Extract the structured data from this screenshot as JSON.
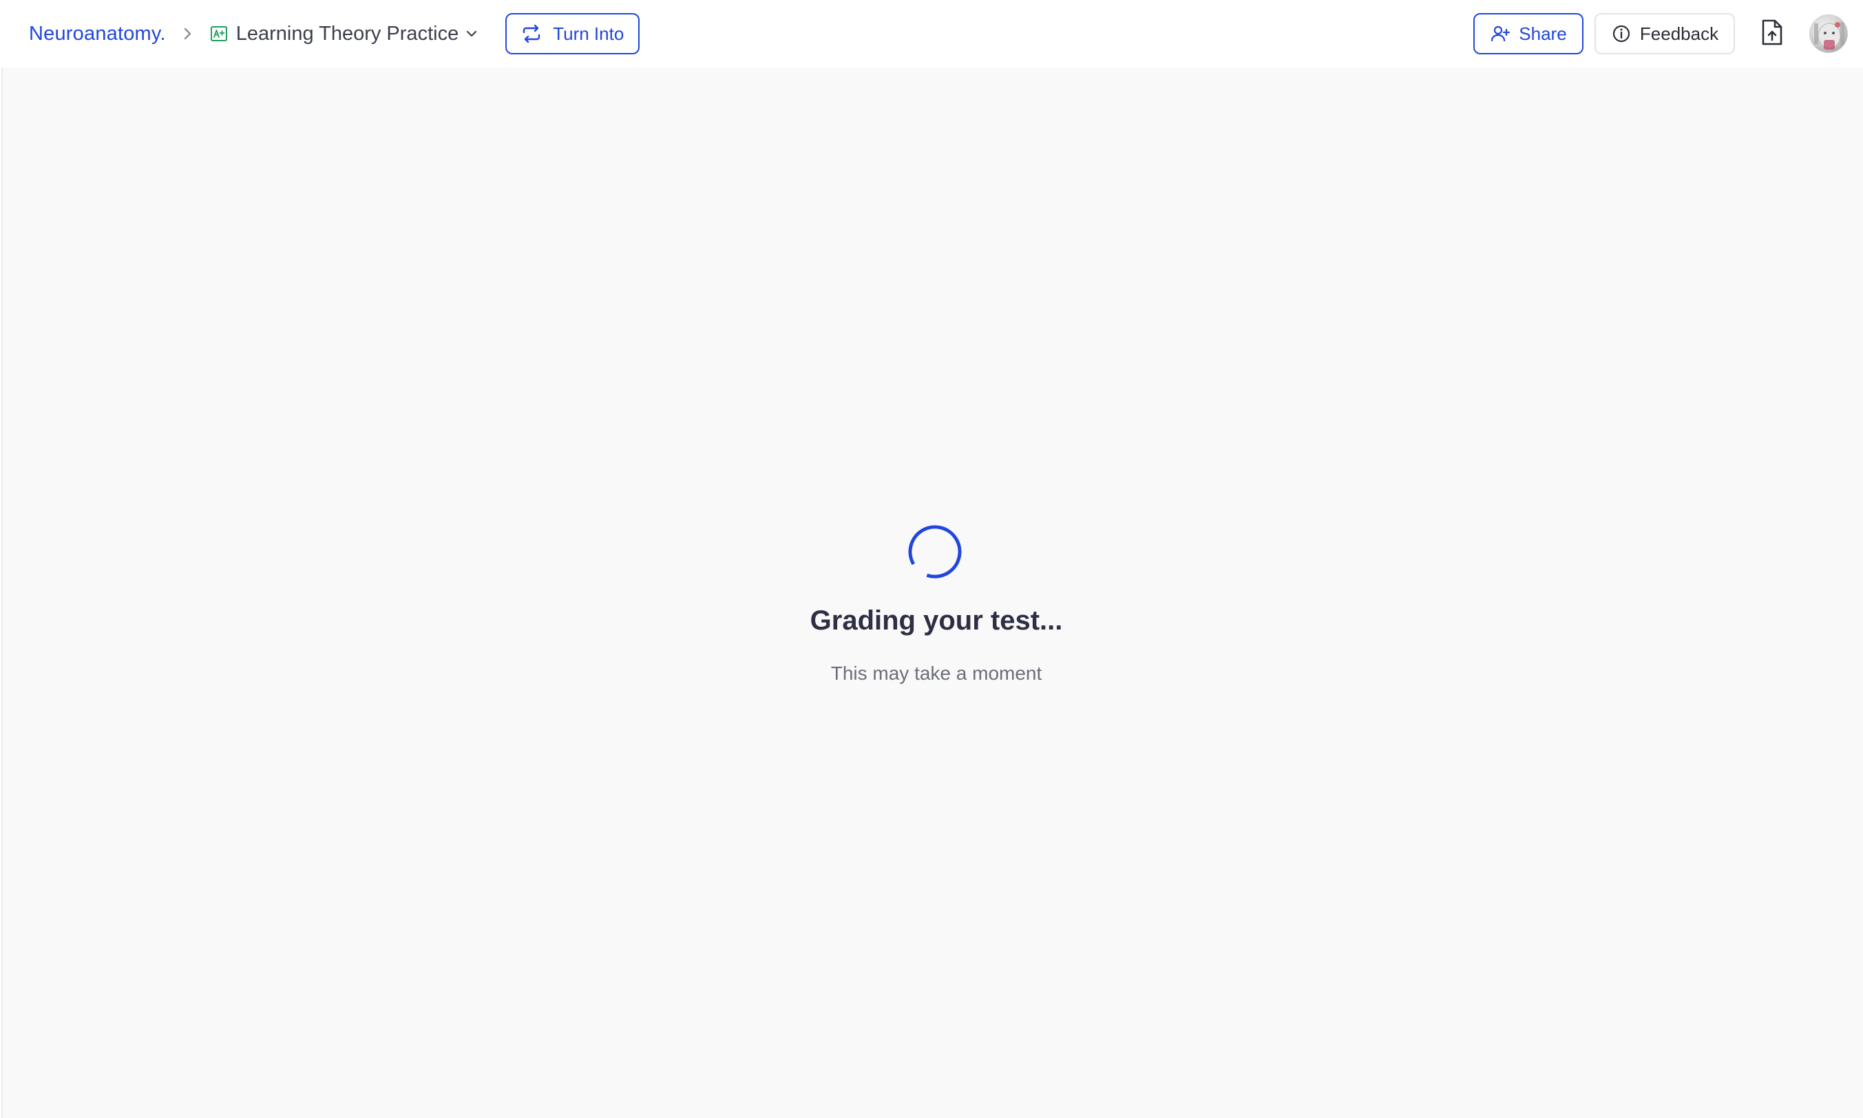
{
  "header": {
    "breadcrumb_root": "Neuroanatomy.",
    "breadcrumb_current": "Learning Theory Practice",
    "turn_into_label": "Turn Into",
    "share_label": "Share",
    "feedback_label": "Feedback"
  },
  "loading": {
    "title": "Grading your test...",
    "subtitle": "This may take a moment"
  },
  "icons": {
    "breadcrumb_separator": "chevron-right-icon",
    "doc_type": "a-plus-grade-icon",
    "dropdown": "chevron-down-icon",
    "turn_into": "repeat-arrows-icon",
    "share": "user-plus-icon",
    "feedback": "info-circle-icon",
    "export": "file-upload-icon",
    "spinner": "loading-spinner-icon"
  },
  "colors": {
    "accent": "#2146e0",
    "doc_icon": "#1e9e5a",
    "title_text": "#2e2f45",
    "subtitle_text": "#6b6e7a",
    "background": "#f9f9f9"
  }
}
